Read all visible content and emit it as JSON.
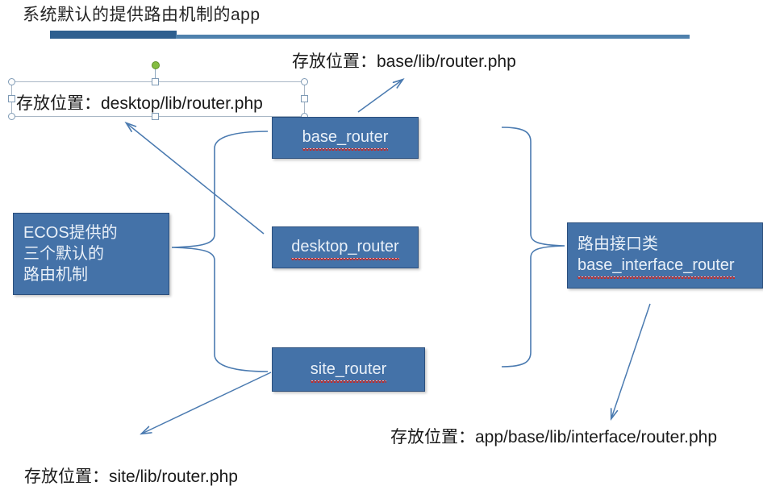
{
  "slide": {
    "title": "系统默认的提供路由机制的app",
    "accent_dark": "#2e5f8f",
    "accent_light": "#4f81ad",
    "box_fill": "#4472a8",
    "box_border": "#2b4f7d",
    "connector_color": "#4a7ab0",
    "spellcheck_color": "#c02b2b",
    "rotation_handle_color": "#84bd41"
  },
  "labels": {
    "desktop_path": "存放位置：desktop/lib/router.php",
    "base_path": "存放位置：base/lib/router.php",
    "site_path": "存放位置：site/lib/router.php",
    "interface_path": "存放位置：app/base/lib/interface/router.php"
  },
  "boxes": {
    "ecos": {
      "line1": "ECOS提供的",
      "line2": "三个默认的",
      "line3": "路由机制"
    },
    "base_router": {
      "label": "base_router"
    },
    "desktop_router": {
      "label": "desktop_router"
    },
    "site_router": {
      "label": "site_router"
    },
    "interface": {
      "line1": "路由接口类",
      "line2": "base_interface_router"
    }
  }
}
